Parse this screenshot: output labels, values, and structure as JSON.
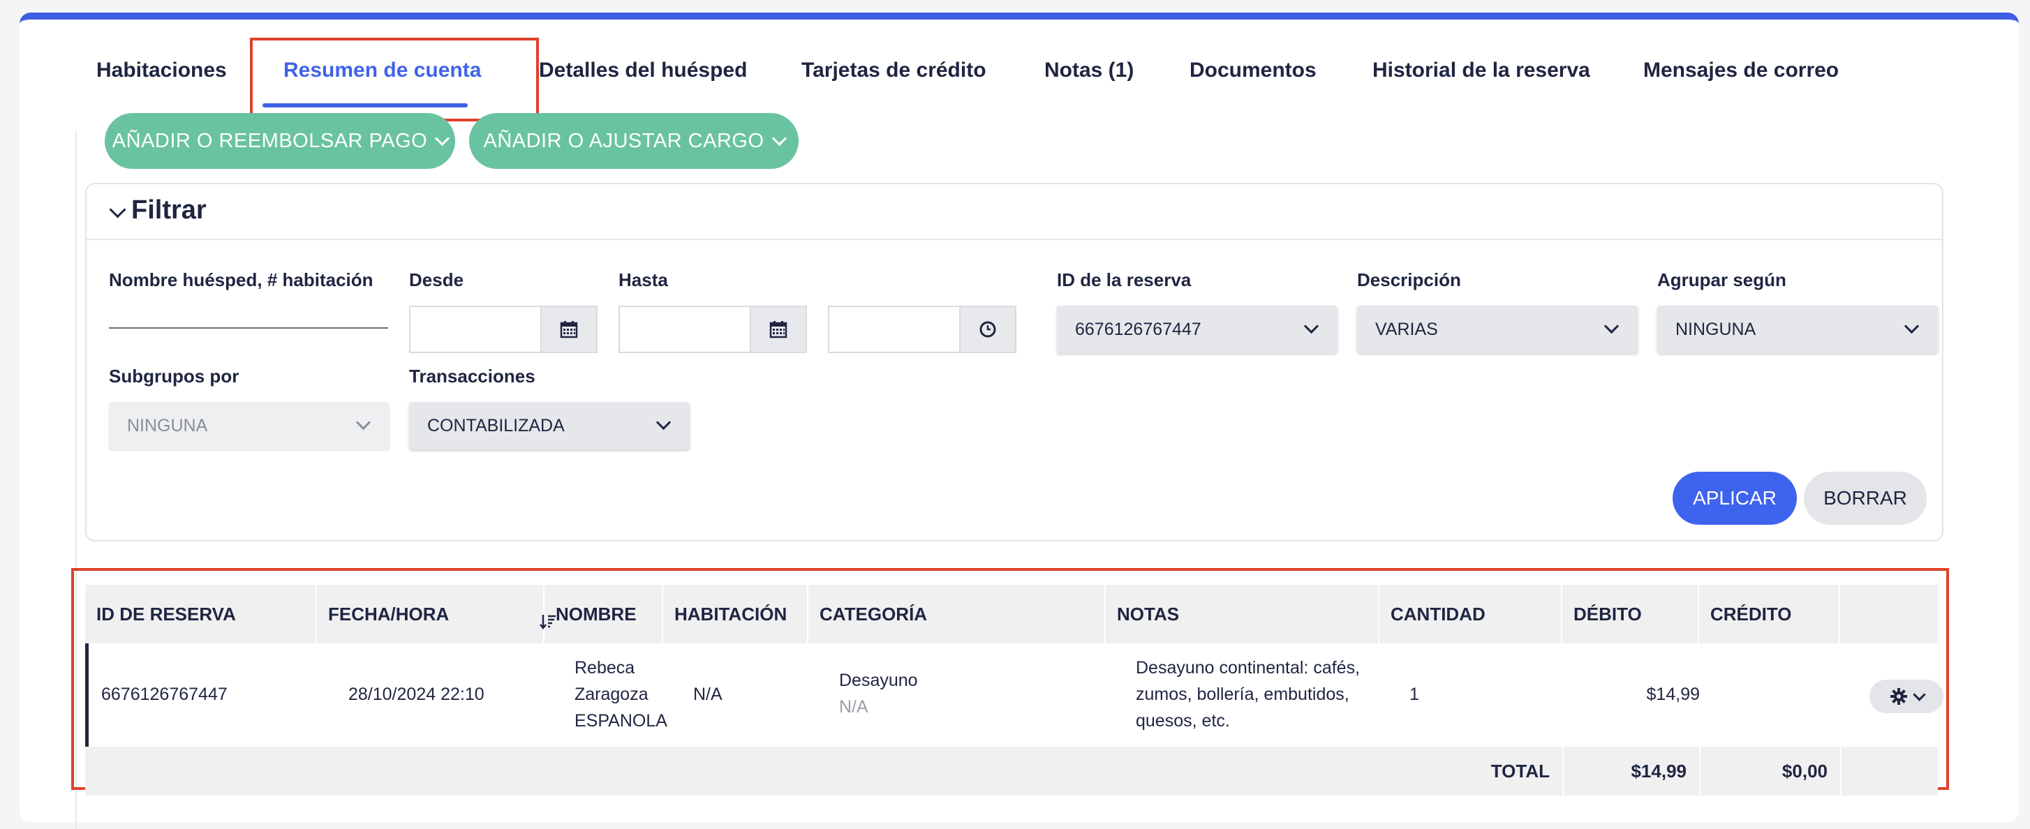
{
  "tabs": [
    {
      "label": "Habitaciones"
    },
    {
      "label": "Resumen de cuenta"
    },
    {
      "label": "Detalles del huésped"
    },
    {
      "label": "Tarjetas de crédito"
    },
    {
      "label": "Notas (1)"
    },
    {
      "label": "Documentos"
    },
    {
      "label": "Historial de la reserva"
    },
    {
      "label": "Mensajes de correo"
    }
  ],
  "actions": {
    "payment_label": "AÑADIR O REEMBOLSAR PAGO",
    "charge_label": "AÑADIR O AJUSTAR CARGO"
  },
  "filter": {
    "title": "Filtrar",
    "guest_label": "Nombre huésped, # habitación",
    "from_label": "Desde",
    "to_label": "Hasta",
    "reservation_label": "ID de la reserva",
    "reservation_value": "6676126767447",
    "description_label": "Descripción",
    "description_value": "VARIAS",
    "group_label": "Agrupar según",
    "group_value": "NINGUNA",
    "subgroup_label": "Subgrupos por",
    "subgroup_value": "NINGUNA",
    "transactions_label": "Transacciones",
    "transactions_value": "CONTABILIZADA",
    "apply_label": "APLICAR",
    "clear_label": "BORRAR"
  },
  "table": {
    "columns": [
      "ID DE RESERVA",
      "FECHA/HORA",
      "NOMBRE",
      "HABITACIÓN",
      "CATEGORÍA",
      "NOTAS",
      "CANTIDAD",
      "DÉBITO",
      "CRÉDITO"
    ],
    "rows": [
      {
        "reservation_id": "6676126767447",
        "datetime": "28/10/2024 22:10",
        "name_line1": "Rebeca",
        "name_line2": "Zaragoza",
        "name_line3": "ESPANOLA",
        "room": "N/A",
        "category": "Desayuno",
        "category_sub": "N/A",
        "notes_line1": "Desayuno continental: cafés,",
        "notes_line2": "zumos, bollería, embutidos,",
        "notes_line3": "quesos, etc.",
        "quantity": "1",
        "debit": "$14,99",
        "credit": ""
      }
    ],
    "footer": {
      "total_label": "TOTAL",
      "debit_total": "$14,99",
      "credit_total": "$0,00"
    }
  },
  "colors": {
    "accent": "#3f63e6",
    "action_green": "#69c3a0",
    "highlight_red": "#e0412a"
  }
}
